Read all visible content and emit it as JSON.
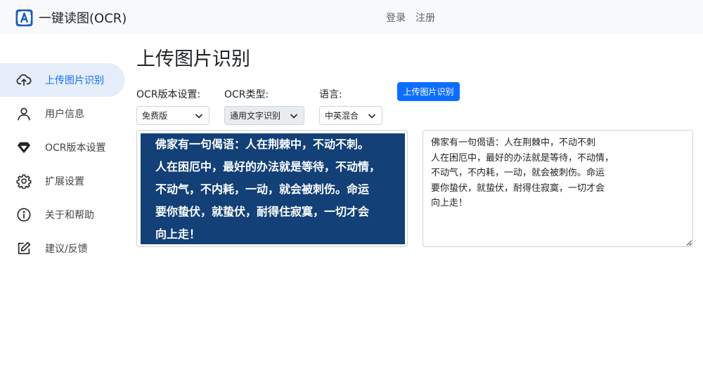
{
  "navbar": {
    "brand": "一键读图(OCR)",
    "login": "登录",
    "register": "注册"
  },
  "sidebar": {
    "items": [
      {
        "label": "上传图片识别",
        "icon": "cloud-upload-icon",
        "active": true
      },
      {
        "label": "用户信息",
        "icon": "user-icon"
      },
      {
        "label": "OCR版本设置",
        "icon": "diamond-icon"
      },
      {
        "label": "扩展设置",
        "icon": "gear-icon"
      },
      {
        "label": "关于和帮助",
        "icon": "info-icon"
      },
      {
        "label": "建议/反馈",
        "icon": "edit-icon"
      }
    ]
  },
  "main": {
    "title": "上传图片识别",
    "ocr_version": {
      "label": "OCR版本设置:",
      "value": "免费版"
    },
    "ocr_type": {
      "label": "OCR类型:",
      "value": "通用文字识别"
    },
    "language": {
      "label": "语言:",
      "value": "中英混合"
    },
    "upload_button": "上传图片识别",
    "image_lines": [
      "佛家有一句偈语：人在荆棘中，不动不刺。",
      "人在困厄中，最好的办法就是等待，不动情，",
      "不动气，不内耗，一动，就会被刺伤。命运",
      "要你蛰伏，就蛰伏，耐得住寂寞，一切才会",
      "向上走！"
    ],
    "result_text": "佛家有一句偈语：人在荆棘中，不动不刺\n人在困厄中，最好的办法就是等待，不动情，\n不动气，不内耗，一动，就会被刺伤。命运\n要你蛰伏，就蛰伏，耐得住寂寞，一切才会\n向上走！"
  },
  "colors": {
    "accent": "#0d6efd",
    "image_bg": "#124077",
    "active_bg": "#e6eefc"
  }
}
